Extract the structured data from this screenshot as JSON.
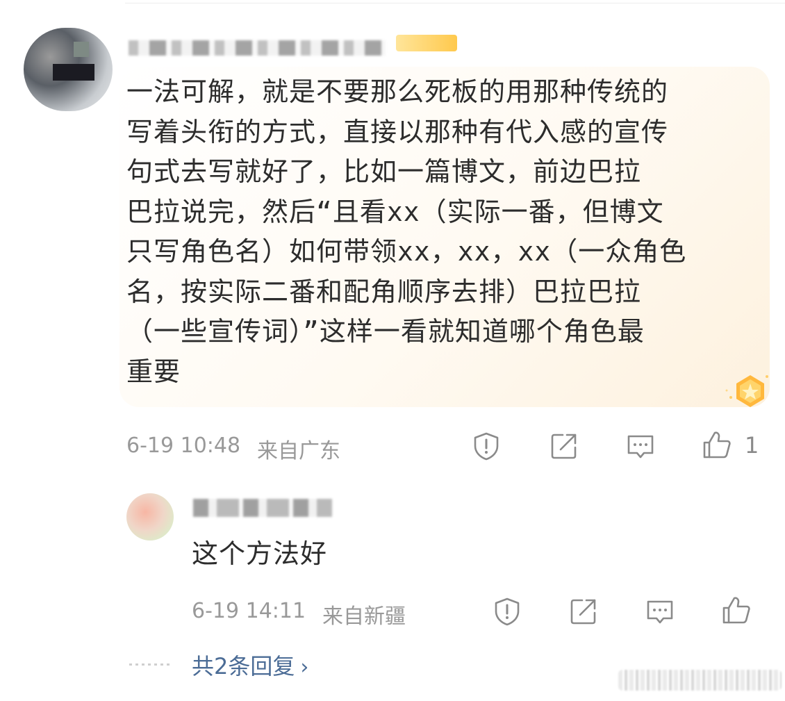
{
  "main_comment": {
    "text": "一法可解，就是不要那么死板的用那种传统的\n写着头衔的方式，直接以那种有代入感的宣传\n句式去写就好了，比如一篇博文，前边巴拉\n巴拉说完，然后“且看xx（实际一番，但博文\n只写角色名）如何带领xx，xx，xx（一众角色\n名，按实际二番和配角顺序去排）巴拉巴拉\n（一些宣传词）”这样一看就知道哪个角色最\n重要",
    "time": "6-19 10:48",
    "location": "来自广东",
    "like_count": "1"
  },
  "reply": {
    "text": "这个方法好",
    "time": "6-19 14:11",
    "location": "来自新疆"
  },
  "more_replies": {
    "label": "共2条回复",
    "chevron": "›"
  },
  "icons": [
    "report-icon",
    "repost-icon",
    "comment-icon",
    "like-icon",
    "medal-icon"
  ],
  "colors": {
    "link": "#4b6c96",
    "meta": "#999999",
    "bubble": "#fdf1de"
  }
}
